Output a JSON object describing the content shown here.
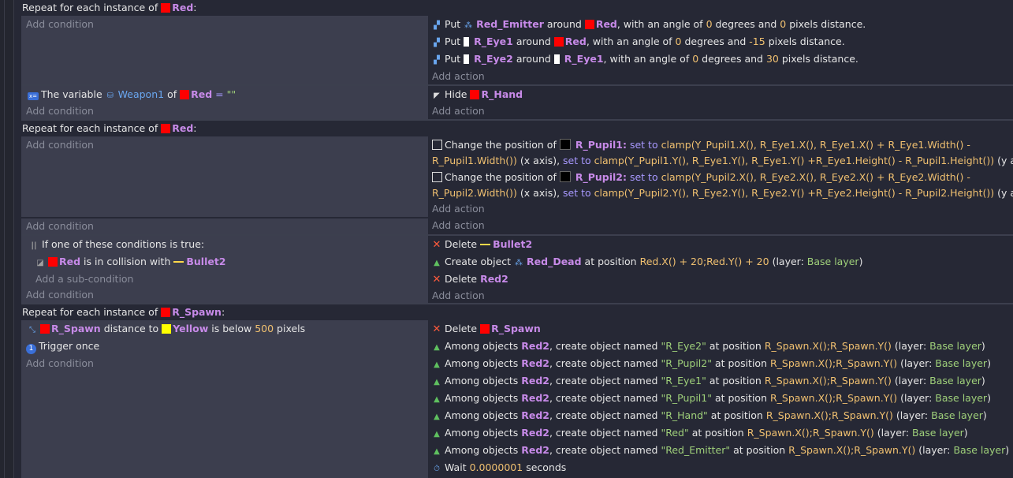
{
  "common": {
    "add_condition": "Add condition",
    "add_action": "Add action",
    "add_subcondition": "Add a sub-condition"
  },
  "icons": [
    "cube-move-icon",
    "emitter-icon",
    "variable-icon",
    "hide-icon",
    "checkbox-icon",
    "or-icon",
    "collision-icon",
    "delete-icon",
    "create-icon",
    "distance-icon",
    "trigger-once-icon",
    "wait-icon"
  ],
  "ev1": {
    "header": {
      "prefix": "Repeat for each instance of",
      "obj": "Red",
      "suffix": ":"
    },
    "actions": [
      {
        "put": "Put",
        "obj1": "Red_Emitter",
        "around": "around",
        "obj2": "Red",
        "t1": ", with an angle of",
        "angle": "0",
        "t2": "degrees and",
        "dist": "0",
        "t3": "pixels distance."
      },
      {
        "put": "Put",
        "obj1": "R_Eye1",
        "around": "around",
        "obj2": "Red",
        "t1": ", with an angle of",
        "angle": "0",
        "t2": "degrees and",
        "dist": "-15",
        "t3": "pixels distance."
      },
      {
        "put": "Put",
        "obj1": "R_Eye2",
        "around": "around",
        "obj2": "R_Eye1",
        "t1": ", with an angle of",
        "angle": "0",
        "t2": "degrees and",
        "dist": "30",
        "t3": "pixels distance."
      }
    ]
  },
  "ev2": {
    "cond": {
      "pre": "The variable",
      "var": "Weapon1",
      "of": "of",
      "obj": "Red",
      "op": "=",
      "val": "\"\""
    },
    "action": {
      "verb": "Hide",
      "obj": "R_Hand"
    }
  },
  "ev3": {
    "header": {
      "prefix": "Repeat for each instance of",
      "obj": "Red",
      "suffix": ":"
    },
    "actions": [
      {
        "pre": "Change the position of",
        "obj": "R_Pupil1:",
        "set1": "set to",
        "expr1a": "clamp(Y_Pupil1.X(), R_Eye1.X(), R_Eye1.X() + R_Eye1.Width() -",
        "expr1b": "R_Pupil1.Width())",
        "axis1": "(x axis),",
        "set2": "set to",
        "expr2": "clamp(Y_Pupil1.Y(), R_Eye1.Y(), R_Eye1.Y() +R_Eye1.Height() - R_Pupil1.Height())",
        "axis2": "(y axis)"
      },
      {
        "pre": "Change the position of",
        "obj": "R_Pupil2:",
        "set1": "set to",
        "expr1a": "clamp(Y_Pupil2.X(), R_Eye2.X(), R_Eye2.X() + R_Eye2.Width() -",
        "expr1b": "R_Pupil2.Width())",
        "axis1": "(x axis),",
        "set2": "set to",
        "expr2": "clamp(Y_Pupil2.Y(), R_Eye2.Y(), R_Eye2.Y() +R_Eye2.Height() - R_Pupil2.Height())",
        "axis2": "(y axis)"
      }
    ]
  },
  "ev4": {
    "or": "If one of these conditions is true:",
    "sub": {
      "obj": "Red",
      "mid": "is in collision with",
      "obj2": "Bullet2"
    },
    "actions": {
      "del1": {
        "verb": "Delete",
        "obj": "Bullet2"
      },
      "create": {
        "verb": "Create object",
        "obj": "Red_Dead",
        "at": "at position",
        "pos": "Red.X() + 20;Red.Y() + 20",
        "layer_pre": "(layer:",
        "layer": "Base layer",
        "layer_post": ")"
      },
      "del2": {
        "verb": "Delete",
        "obj": "Red2"
      }
    }
  },
  "ev5": {
    "header": {
      "prefix": "Repeat for each instance of",
      "obj": "R_Spawn",
      "suffix": ":"
    },
    "cond1": {
      "obj": "R_Spawn",
      "mid": "distance to",
      "obj2": "Yellow",
      "mid2": "is below",
      "num": "500",
      "post": "pixels"
    },
    "cond2": "Trigger once",
    "del": {
      "verb": "Delete",
      "obj": "R_Spawn"
    },
    "creates": [
      {
        "name": "\"R_Eye2\""
      },
      {
        "name": "\"R_Pupil2\""
      },
      {
        "name": "\"R_Eye1\""
      },
      {
        "name": "\"R_Pupil1\""
      },
      {
        "name": "\"R_Hand\""
      },
      {
        "name": "\"Red\""
      },
      {
        "name": "\"Red_Emitter\""
      }
    ],
    "create_pre": "Among objects",
    "create_obj": "Red2",
    "create_mid": ", create object named",
    "create_at": "at position",
    "create_pos": "R_Spawn.X();R_Spawn.Y()",
    "layer_pre": "(layer:",
    "layer": "Base layer",
    "layer_post": ")",
    "wait": {
      "verb": "Wait",
      "num": "0.0000001",
      "post": "seconds"
    }
  }
}
